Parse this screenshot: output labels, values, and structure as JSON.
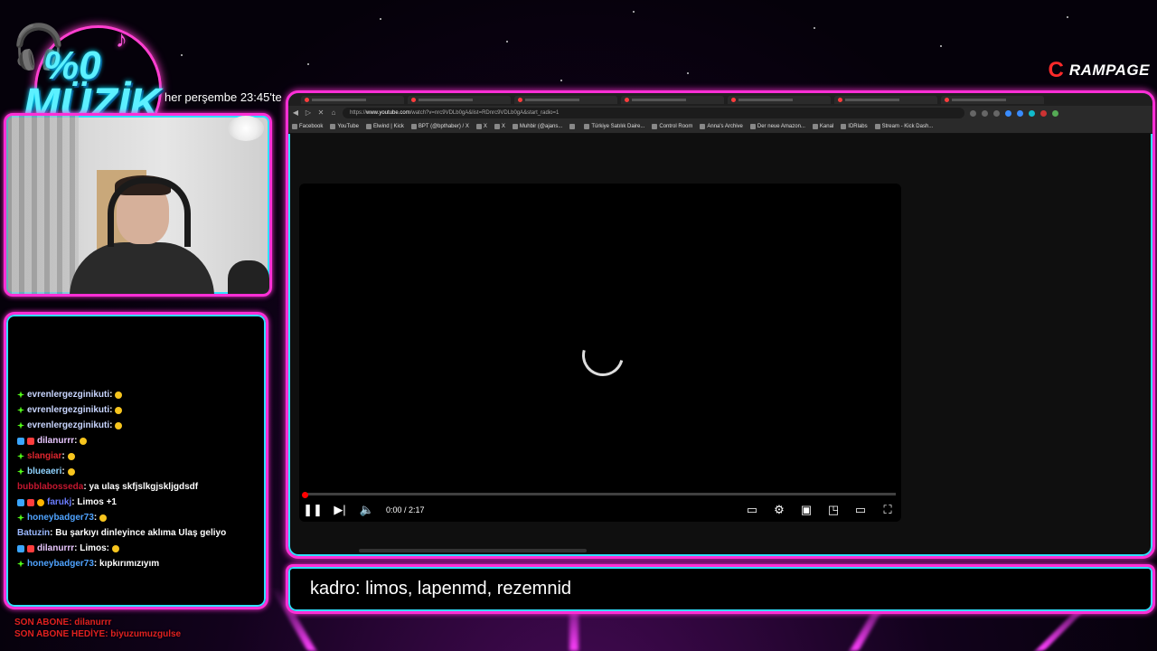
{
  "overlay": {
    "logo_line1": "%0",
    "logo_line2": "MÜZİK",
    "schedule": "her perşembe 23:45'te",
    "brand": "RAMPAGE",
    "caption": "kadro: limos, lapenmd, rezemnid",
    "last_sub": "SON ABONE: dilanurrr",
    "last_gift_sub": "SON ABONE HEDİYE: biyuzumuzgulse",
    "colors": {
      "frame_pink": "#ff2fd6",
      "frame_cyan": "#2fe0ff",
      "kick_green": "#53fc18"
    }
  },
  "chat": {
    "messages": [
      {
        "user": "evrenlergezginikuti",
        "color": "#c9d6ff",
        "text": ":",
        "badges": [
          "green"
        ],
        "emote": true
      },
      {
        "user": "evrenlergezginikuti",
        "color": "#c9d6ff",
        "text": ":",
        "badges": [
          "green"
        ],
        "emote": true
      },
      {
        "user": "evrenlergezginikuti",
        "color": "#c9d6ff",
        "text": ":",
        "badges": [
          "green"
        ],
        "emote": true
      },
      {
        "user": "dilanurrr",
        "color": "#e9c7ff",
        "text": ":",
        "badges": [
          "blue",
          "red"
        ],
        "emote": true
      },
      {
        "user": "slangiar",
        "color": "#e0262e",
        "text": ":",
        "badges": [
          "green"
        ],
        "emote": true
      },
      {
        "user": "blueaeri",
        "color": "#8fd3ff",
        "text": ":",
        "badges": [
          "green"
        ],
        "emote": true
      },
      {
        "user": "bubblabosseda",
        "color": "#c4172f",
        "text": ": ya ulaş skfjslkgjskljgdsdf",
        "badges": [],
        "emote": false
      },
      {
        "user": "farukj",
        "color": "#6a7cff",
        "text": ": Limos +1",
        "badges": [
          "blue",
          "red",
          "gold"
        ],
        "emote": false
      },
      {
        "user": "honeybadger73",
        "color": "#4fa3ff",
        "text": ":",
        "badges": [
          "green"
        ],
        "emote": true
      },
      {
        "user": "Batuzin",
        "color": "#9ab8ff",
        "text": ": Bu şarkıyı dinleyince aklıma Ulaş geliyo",
        "badges": [],
        "emote": false
      },
      {
        "user": "dilanurrr",
        "color": "#e9c7ff",
        "text": ": Limos:",
        "badges": [
          "blue",
          "red"
        ],
        "emote": true
      },
      {
        "user": "honeybadger73",
        "color": "#4fa3ff",
        "text": ": kıpkırımızıyım",
        "badges": [
          "green"
        ],
        "emote": false
      }
    ]
  },
  "browser": {
    "url_prefix": "https://",
    "url_host": "www.youtube.com",
    "url_rest": "/watch?v=nrc9VDLb0gA&list=RDnrc9VDLb0gA&start_radio=1",
    "bookmarks": [
      "Facebook",
      "YouTube",
      "Elwind | Kick",
      "BPT (@bpthaber) / X",
      "X",
      "X",
      "Muhbir (@ajans...",
      "",
      "Türkiye Satılık Daire...",
      "Control Room",
      "Anna's Archive",
      "Der neue Amazon...",
      "Kanal",
      "IDRlabs",
      "Stream - Kick Dash..."
    ],
    "player": {
      "time": "0:00 / 2:17",
      "progress": 0.0
    }
  }
}
